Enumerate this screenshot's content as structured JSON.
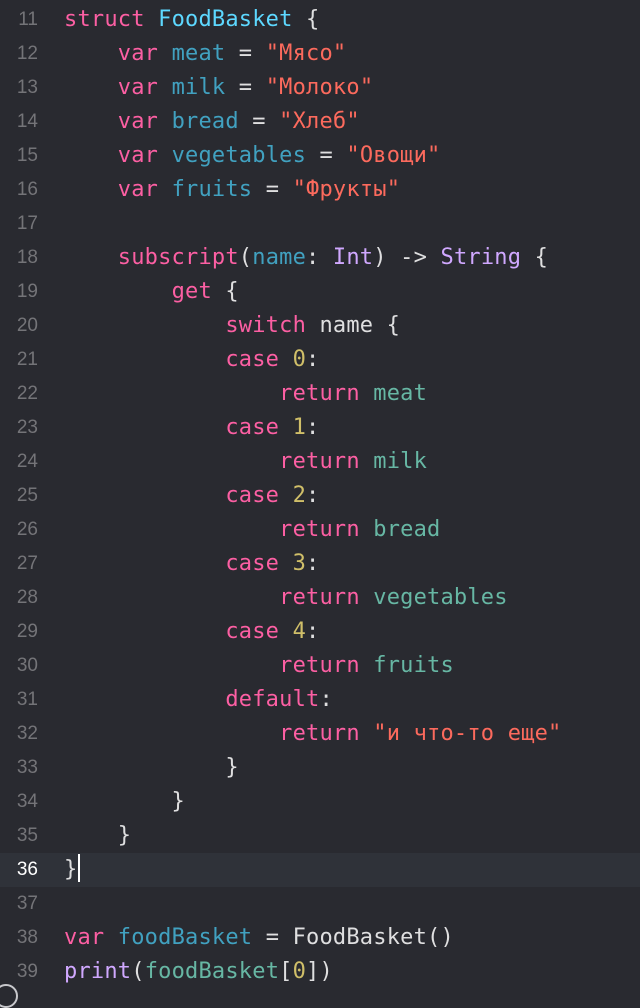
{
  "colors": {
    "background": "#292a30",
    "current_line": "#2f3239",
    "gutter": "#747478",
    "gutter_current": "#ffffff",
    "plain": "#dfdfe0",
    "keyword": "#fc5fa3",
    "string": "#fc6a5d",
    "number": "#d0bf69",
    "type_decl": "#5dd8ff",
    "type_ref": "#d0a8ff",
    "property": "#67b7a4",
    "param": "#41a1c0"
  },
  "editor": {
    "current_line_number": 36,
    "lines": [
      {
        "number": 11,
        "tokens": [
          {
            "t": "struct",
            "c": "keyword"
          },
          {
            "t": " "
          },
          {
            "t": "FoodBasket",
            "c": "type_decl"
          },
          {
            "t": " {"
          }
        ]
      },
      {
        "number": 12,
        "tokens": [
          {
            "t": "    "
          },
          {
            "t": "var",
            "c": "keyword"
          },
          {
            "t": " "
          },
          {
            "t": "meat",
            "c": "param"
          },
          {
            "t": " = "
          },
          {
            "t": "\"Мясо\"",
            "c": "string"
          }
        ]
      },
      {
        "number": 13,
        "tokens": [
          {
            "t": "    "
          },
          {
            "t": "var",
            "c": "keyword"
          },
          {
            "t": " "
          },
          {
            "t": "milk",
            "c": "param"
          },
          {
            "t": " = "
          },
          {
            "t": "\"Молоко\"",
            "c": "string"
          }
        ]
      },
      {
        "number": 14,
        "tokens": [
          {
            "t": "    "
          },
          {
            "t": "var",
            "c": "keyword"
          },
          {
            "t": " "
          },
          {
            "t": "bread",
            "c": "param"
          },
          {
            "t": " = "
          },
          {
            "t": "\"Хлеб\"",
            "c": "string"
          }
        ]
      },
      {
        "number": 15,
        "tokens": [
          {
            "t": "    "
          },
          {
            "t": "var",
            "c": "keyword"
          },
          {
            "t": " "
          },
          {
            "t": "vegetables",
            "c": "param"
          },
          {
            "t": " = "
          },
          {
            "t": "\"Овощи\"",
            "c": "string"
          }
        ]
      },
      {
        "number": 16,
        "tokens": [
          {
            "t": "    "
          },
          {
            "t": "var",
            "c": "keyword"
          },
          {
            "t": " "
          },
          {
            "t": "fruits",
            "c": "param"
          },
          {
            "t": " = "
          },
          {
            "t": "\"Фрукты\"",
            "c": "string"
          }
        ]
      },
      {
        "number": 17,
        "tokens": []
      },
      {
        "number": 18,
        "tokens": [
          {
            "t": "    "
          },
          {
            "t": "subscript",
            "c": "keyword"
          },
          {
            "t": "("
          },
          {
            "t": "name",
            "c": "param"
          },
          {
            "t": ": "
          },
          {
            "t": "Int",
            "c": "type_ref"
          },
          {
            "t": ") -> "
          },
          {
            "t": "String",
            "c": "type_ref"
          },
          {
            "t": " {"
          }
        ]
      },
      {
        "number": 19,
        "tokens": [
          {
            "t": "        "
          },
          {
            "t": "get",
            "c": "keyword"
          },
          {
            "t": " {"
          }
        ]
      },
      {
        "number": 20,
        "tokens": [
          {
            "t": "            "
          },
          {
            "t": "switch",
            "c": "keyword"
          },
          {
            "t": " name {"
          }
        ]
      },
      {
        "number": 21,
        "tokens": [
          {
            "t": "            "
          },
          {
            "t": "case",
            "c": "keyword"
          },
          {
            "t": " "
          },
          {
            "t": "0",
            "c": "number"
          },
          {
            "t": ":"
          }
        ]
      },
      {
        "number": 22,
        "tokens": [
          {
            "t": "                "
          },
          {
            "t": "return",
            "c": "keyword"
          },
          {
            "t": " "
          },
          {
            "t": "meat",
            "c": "property"
          }
        ]
      },
      {
        "number": 23,
        "tokens": [
          {
            "t": "            "
          },
          {
            "t": "case",
            "c": "keyword"
          },
          {
            "t": " "
          },
          {
            "t": "1",
            "c": "number"
          },
          {
            "t": ":"
          }
        ]
      },
      {
        "number": 24,
        "tokens": [
          {
            "t": "                "
          },
          {
            "t": "return",
            "c": "keyword"
          },
          {
            "t": " "
          },
          {
            "t": "milk",
            "c": "property"
          }
        ]
      },
      {
        "number": 25,
        "tokens": [
          {
            "t": "            "
          },
          {
            "t": "case",
            "c": "keyword"
          },
          {
            "t": " "
          },
          {
            "t": "2",
            "c": "number"
          },
          {
            "t": ":"
          }
        ]
      },
      {
        "number": 26,
        "tokens": [
          {
            "t": "                "
          },
          {
            "t": "return",
            "c": "keyword"
          },
          {
            "t": " "
          },
          {
            "t": "bread",
            "c": "property"
          }
        ]
      },
      {
        "number": 27,
        "tokens": [
          {
            "t": "            "
          },
          {
            "t": "case",
            "c": "keyword"
          },
          {
            "t": " "
          },
          {
            "t": "3",
            "c": "number"
          },
          {
            "t": ":"
          }
        ]
      },
      {
        "number": 28,
        "tokens": [
          {
            "t": "                "
          },
          {
            "t": "return",
            "c": "keyword"
          },
          {
            "t": " "
          },
          {
            "t": "vegetables",
            "c": "property"
          }
        ]
      },
      {
        "number": 29,
        "tokens": [
          {
            "t": "            "
          },
          {
            "t": "case",
            "c": "keyword"
          },
          {
            "t": " "
          },
          {
            "t": "4",
            "c": "number"
          },
          {
            "t": ":"
          }
        ]
      },
      {
        "number": 30,
        "tokens": [
          {
            "t": "                "
          },
          {
            "t": "return",
            "c": "keyword"
          },
          {
            "t": " "
          },
          {
            "t": "fruits",
            "c": "property"
          }
        ]
      },
      {
        "number": 31,
        "tokens": [
          {
            "t": "            "
          },
          {
            "t": "default",
            "c": "keyword"
          },
          {
            "t": ":"
          }
        ]
      },
      {
        "number": 32,
        "tokens": [
          {
            "t": "                "
          },
          {
            "t": "return",
            "c": "keyword"
          },
          {
            "t": " "
          },
          {
            "t": "\"и что-то еще\"",
            "c": "string"
          }
        ]
      },
      {
        "number": 33,
        "tokens": [
          {
            "t": "            }"
          }
        ]
      },
      {
        "number": 34,
        "tokens": [
          {
            "t": "        }"
          }
        ]
      },
      {
        "number": 35,
        "tokens": [
          {
            "t": "    }"
          }
        ]
      },
      {
        "number": 36,
        "tokens": [
          {
            "t": "}"
          }
        ]
      },
      {
        "number": 37,
        "tokens": []
      },
      {
        "number": 38,
        "tokens": [
          {
            "t": "var",
            "c": "keyword"
          },
          {
            "t": " "
          },
          {
            "t": "foodBasket",
            "c": "param"
          },
          {
            "t": " = FoodBasket()"
          }
        ]
      },
      {
        "number": 39,
        "tokens": [
          {
            "t": "print",
            "c": "type_ref"
          },
          {
            "t": "("
          },
          {
            "t": "foodBasket",
            "c": "property"
          },
          {
            "t": "["
          },
          {
            "t": "0",
            "c": "number"
          },
          {
            "t": "])"
          }
        ]
      }
    ]
  }
}
